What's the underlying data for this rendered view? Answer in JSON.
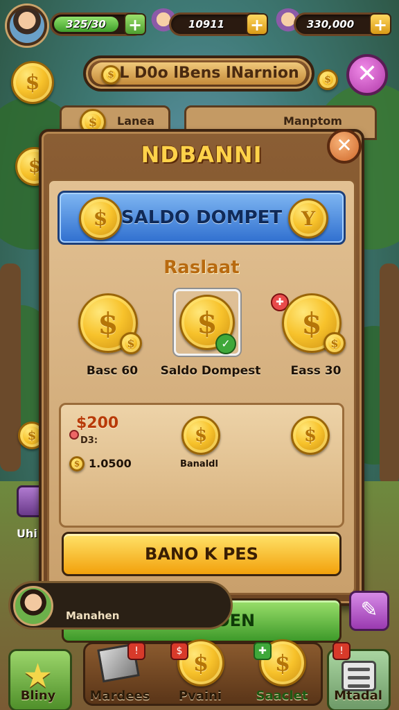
{
  "hud": {
    "energy_value": "325/30",
    "gems_value": "10911",
    "gold_value": "330,000",
    "plus_label": "+"
  },
  "banner": {
    "title": "L D0o lBens lNarnion",
    "close_symbol": "✕"
  },
  "back_tabs": {
    "left_label": "Lanea",
    "right_label": "Manptom"
  },
  "side": {
    "left_label": "Uhi"
  },
  "panel": {
    "title": "NDBANNI",
    "close_symbol": "✕",
    "wallet_label": "SALDO DOMPET",
    "section_title": "Raslaat",
    "options": [
      {
        "label": "Basc 60",
        "selected": false
      },
      {
        "label": "Saldo Dompest",
        "selected": true
      },
      {
        "label": "Eass 30",
        "selected": false
      }
    ],
    "summary": {
      "amount": "$200",
      "unit": "D3:",
      "balance": "1.0500",
      "mid_label": "Banaldl"
    },
    "primary_button": "BANO K PES",
    "secondary_button": "MIN KKOEN"
  },
  "player": {
    "name": "Manahen"
  },
  "bottom_nav": [
    {
      "label": "Bliny",
      "icon": "star-icon"
    },
    {
      "label": "Mardees",
      "icon": "box-icon"
    },
    {
      "label": "Pvaini",
      "icon": "coin-icon"
    },
    {
      "label": "Saaclet",
      "icon": "coin-icon"
    },
    {
      "label": "Mtadal",
      "icon": "menu-icon"
    }
  ],
  "colors": {
    "accent_gold": "#f7c22b",
    "wallet_blue": "#2f6fcf",
    "button_yellow": "#f2a10c",
    "button_green": "#3e9a2a",
    "panel_wood": "#8b5e34"
  }
}
